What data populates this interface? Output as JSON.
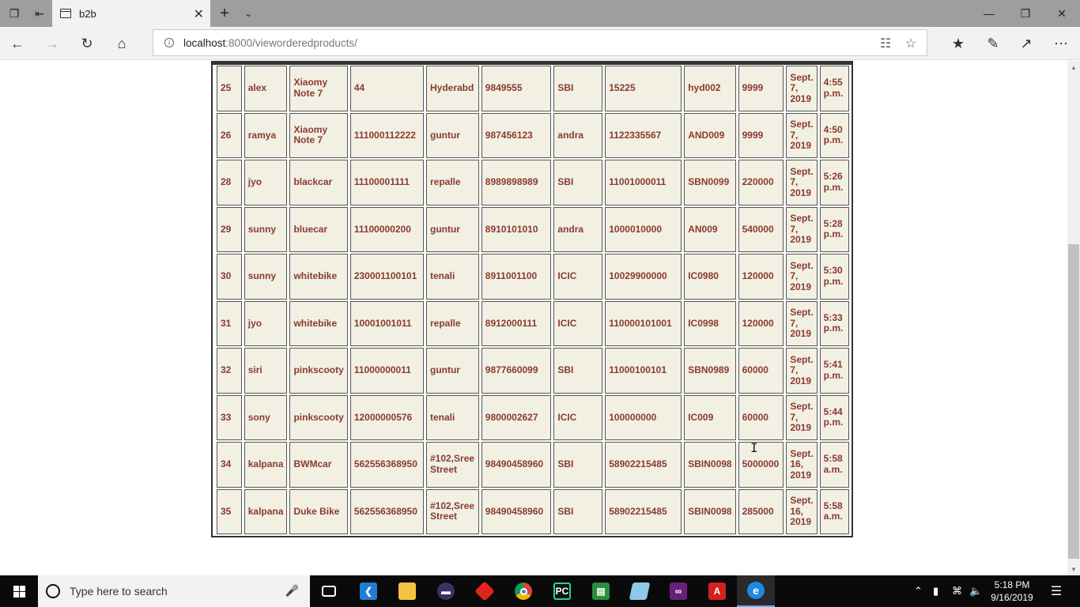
{
  "browser": {
    "tab_title": "b2b",
    "url_host": "localhost",
    "url_path": ":8000/vieworderedproducts/"
  },
  "orders": [
    [
      "25",
      "alex",
      "Xiaomy Note 7",
      "44",
      "Hyderabd",
      "9849555",
      "SBI",
      "15225",
      "hyd002",
      "9999",
      "Sept. 7, 2019",
      "4:55 p.m."
    ],
    [
      "26",
      "ramya",
      "Xiaomy Note 7",
      "111000112222",
      "guntur",
      "987456123",
      "andra",
      "1122335567",
      "AND009",
      "9999",
      "Sept. 7, 2019",
      "4:50 p.m."
    ],
    [
      "28",
      "jyo",
      "blackcar",
      "11100001111",
      "repalle",
      "8989898989",
      "SBI",
      "11001000011",
      "SBN0099",
      "220000",
      "Sept. 7, 2019",
      "5:26 p.m."
    ],
    [
      "29",
      "sunny",
      "bluecar",
      "11100000200",
      "guntur",
      "8910101010",
      "andra",
      "1000010000",
      "AN009",
      "540000",
      "Sept. 7, 2019",
      "5:28 p.m."
    ],
    [
      "30",
      "sunny",
      "whitebike",
      "230001100101",
      "tenali",
      "8911001100",
      "ICIC",
      "10029900000",
      "IC0980",
      "120000",
      "Sept. 7, 2019",
      "5:30 p.m."
    ],
    [
      "31",
      "jyo",
      "whitebike",
      "10001001011",
      "repalle",
      "8912000111",
      "ICIC",
      "110000101001",
      "IC0998",
      "120000",
      "Sept. 7, 2019",
      "5:33 p.m."
    ],
    [
      "32",
      "siri",
      "pinkscooty",
      "11000000011",
      "guntur",
      "9877660099",
      "SBI",
      "11000100101",
      "SBN0989",
      "60000",
      "Sept. 7, 2019",
      "5:41 p.m."
    ],
    [
      "33",
      "sony",
      "pinkscooty",
      "12000000576",
      "tenali",
      "9800002627",
      "ICIC",
      "100000000",
      "IC009",
      "60000",
      "Sept. 7, 2019",
      "5:44 p.m."
    ],
    [
      "34",
      "kalpana",
      "BWMcar",
      "562556368950",
      "#102,Sree Street",
      "98490458960",
      "SBI",
      "58902215485",
      "SBIN0098",
      "5000000",
      "Sept. 16, 2019",
      "5:58 a.m."
    ],
    [
      "35",
      "kalpana",
      "Duke Bike",
      "562556368950",
      "#102,Sree Street",
      "98490458960",
      "SBI",
      "58902215485",
      "SBIN0098",
      "285000",
      "Sept. 16, 2019",
      "5:58 a.m."
    ]
  ],
  "taskbar": {
    "search_placeholder": "Type here to search",
    "time": "5:18 PM",
    "date": "9/16/2019"
  }
}
